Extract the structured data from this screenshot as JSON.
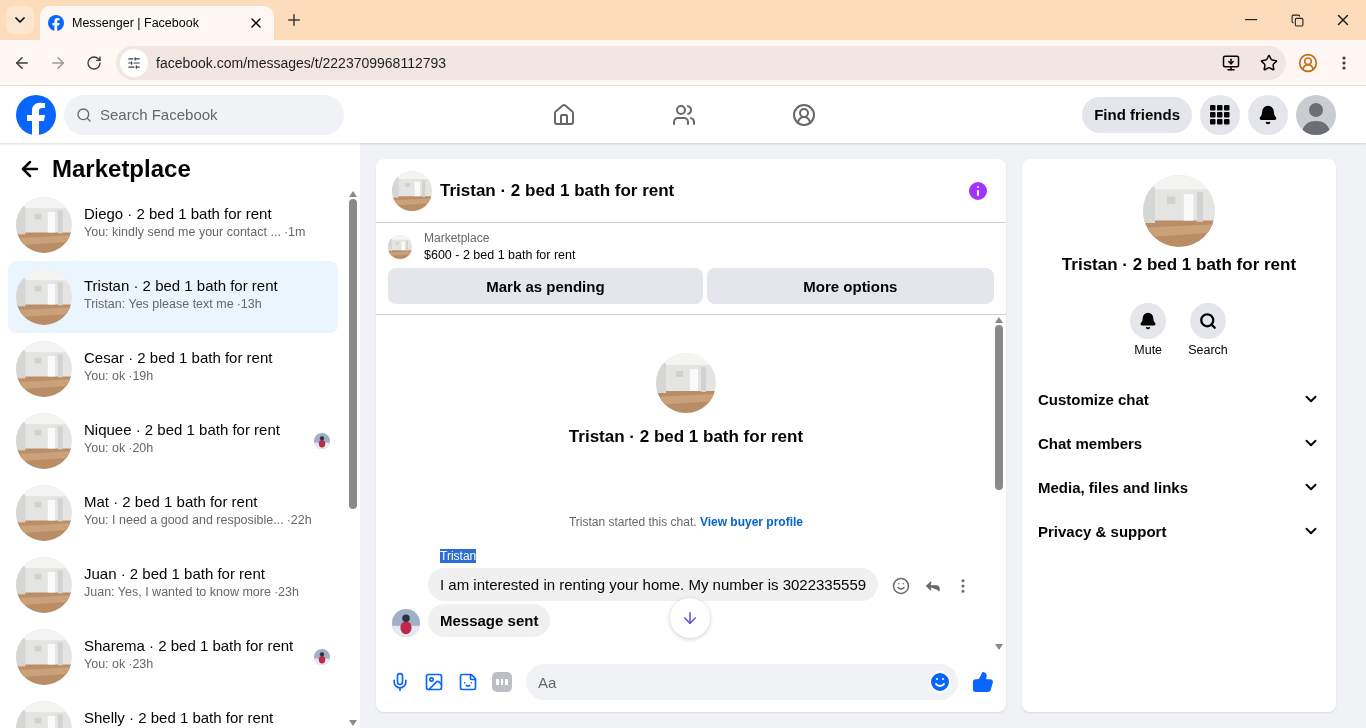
{
  "browser": {
    "tab_title": "Messenger | Facebook",
    "url": "facebook.com/messages/t/2223709968112793"
  },
  "header": {
    "search_placeholder": "Search Facebook",
    "find_friends": "Find friends"
  },
  "sidebar": {
    "title": "Marketplace",
    "conversations": [
      {
        "title": "Diego · 2 bed 1 bath for rent",
        "preview": "You: kindly send me your contact ...",
        "time": "·1m",
        "selected": false,
        "seen": false
      },
      {
        "title": "Tristan · 2 bed 1 bath for rent",
        "preview": "Tristan: Yes please text me",
        "time": "·13h",
        "selected": true,
        "seen": false
      },
      {
        "title": "Cesar · 2 bed 1 bath for rent",
        "preview": "You: ok",
        "time": "·19h",
        "selected": false,
        "seen": false
      },
      {
        "title": "Niquee · 2 bed 1 bath for rent",
        "preview": "You: ok",
        "time": "·20h",
        "selected": false,
        "seen": true
      },
      {
        "title": "Mat · 2 bed 1 bath for rent",
        "preview": "You: I need a good and resposible...",
        "time": "·22h",
        "selected": false,
        "seen": false
      },
      {
        "title": "Juan · 2 bed 1 bath for rent",
        "preview": "Juan: Yes, I wanted to know more",
        "time": "·23h",
        "selected": false,
        "seen": false
      },
      {
        "title": "Sharema · 2 bed 1 bath for rent",
        "preview": "You: ok",
        "time": "·23h",
        "selected": false,
        "seen": true
      },
      {
        "title": "Shelly · 2 bed 1 bath for rent",
        "selected": false,
        "seen": false
      }
    ]
  },
  "chat": {
    "title": "Tristan · 2 bed 1 bath for rent",
    "listing": {
      "label": "Marketplace",
      "text": "$600 - 2 bed 1 bath for rent",
      "buttons": [
        "Mark as pending",
        "More options"
      ]
    },
    "intro": {
      "title": "Tristan · 2 bed 1 bath for rent",
      "note": "Tristan started this chat.",
      "link": "View buyer profile"
    },
    "sender": {
      "name": "Tristan",
      "highlighted": true
    },
    "messages": [
      {
        "text": "I am interested in renting your home. My number is 3022335559",
        "bold": false
      },
      {
        "text": "Message sent",
        "bold": true
      }
    ],
    "composer": {
      "placeholder": "Aa"
    }
  },
  "details": {
    "title": "Tristan · 2 bed 1 bath for rent",
    "actions": [
      {
        "kind": "mute",
        "label": "Mute"
      },
      {
        "kind": "search",
        "label": "Search"
      }
    ],
    "sections": [
      {
        "label": "Customize chat",
        "expanded": false
      },
      {
        "label": "Chat members",
        "expanded": false
      },
      {
        "label": "Media, files and links",
        "expanded": false
      },
      {
        "label": "Privacy & support",
        "expanded": false
      }
    ]
  }
}
